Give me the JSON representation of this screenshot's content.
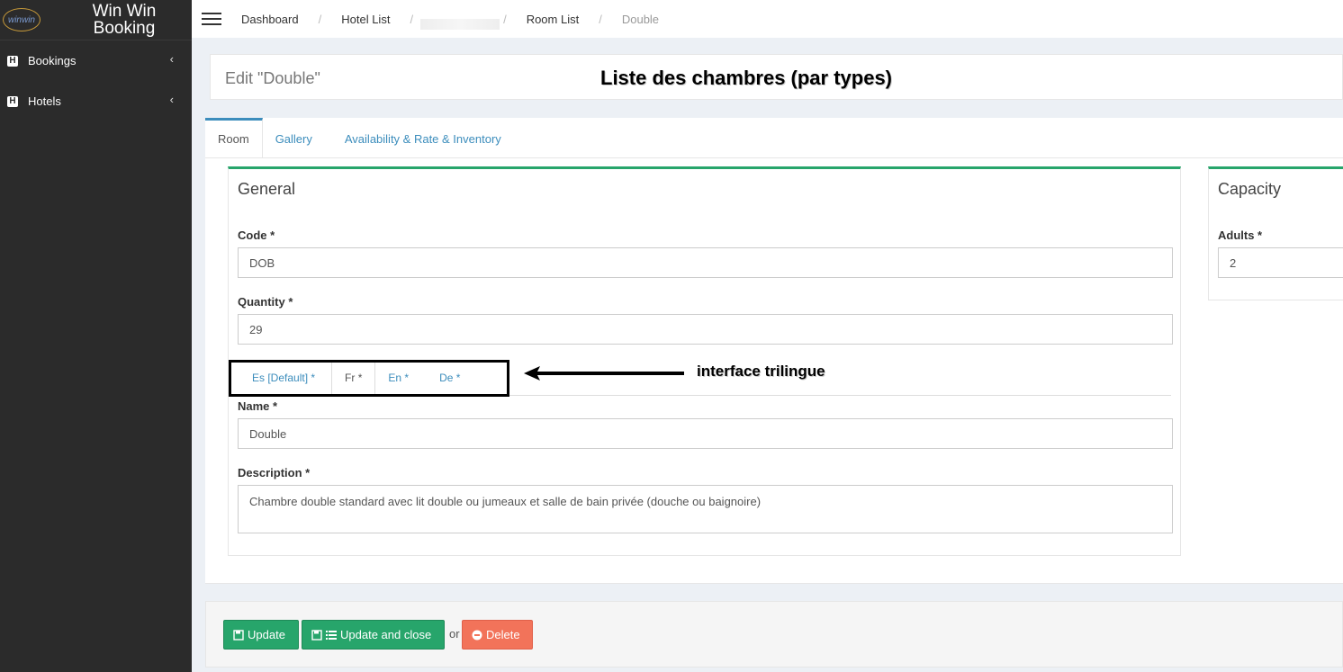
{
  "sidebar": {
    "logo_text": "winwin",
    "brand": "Win Win Booking",
    "items": [
      {
        "label": "Bookings"
      },
      {
        "label": "Hotels"
      }
    ]
  },
  "breadcrumb": [
    "Dashboard",
    "Hotel List",
    "Room List",
    "Double"
  ],
  "page": {
    "title": "Edit \"Double\"",
    "annotation_title": "Liste des chambres (par types)"
  },
  "tabs": [
    "Room",
    "Gallery",
    "Availability & Rate & Inventory"
  ],
  "general": {
    "title": "General",
    "code_label": "Code *",
    "code_value": "DOB",
    "quantity_label": "Quantity *",
    "quantity_value": "29",
    "lang_tabs": [
      "Es [Default] *",
      "Fr *",
      "En *",
      "De *"
    ],
    "name_label": "Name *",
    "name_value": "Double",
    "description_label": "Description *",
    "description_value": "Chambre double standard avec lit double ou jumeaux et salle de bain privée (douche ou baignoire)"
  },
  "capacity": {
    "title": "Capacity",
    "adults_label": "Adults *",
    "adults_value": "2"
  },
  "annotation": "interface trilingue",
  "footer": {
    "update": "Update",
    "update_close": "Update and close",
    "or": "or",
    "delete": "Delete"
  },
  "colors": {
    "green": "#27a56b",
    "red": "#f2735a",
    "link": "#3c8dbc",
    "sidebar": "#2b2b2b"
  }
}
